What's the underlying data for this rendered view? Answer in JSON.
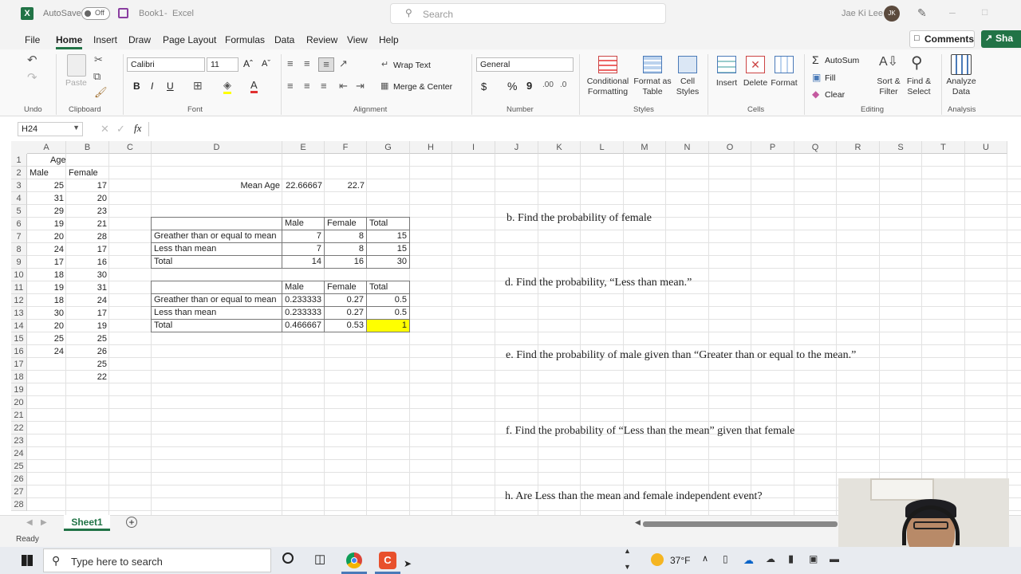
{
  "title_bar": {
    "autosave_label": "AutoSave",
    "autosave_state": "Off",
    "file_name": "Book1",
    "app_name": "Excel",
    "search_placeholder": "Search",
    "user_name": "Jae Ki Lee",
    "user_initials": "JK"
  },
  "menu": {
    "items": [
      "File",
      "Home",
      "Insert",
      "Draw",
      "Page Layout",
      "Formulas",
      "Data",
      "Review",
      "View",
      "Help"
    ],
    "active": "Home",
    "comments_label": "Comments",
    "share_label": "Sha"
  },
  "ribbon": {
    "undo_group": "Undo",
    "clipboard": {
      "group": "Clipboard",
      "paste": "Paste"
    },
    "font": {
      "group": "Font",
      "name": "Calibri",
      "size": "11",
      "bold": "B",
      "italic": "I",
      "underline": "U"
    },
    "alignment": {
      "group": "Alignment",
      "wrap_text": "Wrap Text",
      "merge_center": "Merge & Center"
    },
    "number": {
      "group": "Number",
      "format": "General",
      "currency": "$",
      "percent": "%",
      "comma": "9"
    },
    "styles": {
      "group": "Styles",
      "conditional": "Conditional Formatting",
      "format_table": "Format as Table",
      "cell_styles": "Cell Styles"
    },
    "cells": {
      "group": "Cells",
      "insert": "Insert",
      "delete": "Delete",
      "format": "Format"
    },
    "editing": {
      "group": "Editing",
      "autosum": "AutoSum",
      "fill": "Fill",
      "clear": "Clear",
      "sort_filter": "Sort & Filter",
      "find_select": "Find & Select"
    },
    "analysis": {
      "group": "Analysis",
      "analyze": "Analyze Data"
    }
  },
  "formula_bar": {
    "name_box": "H24",
    "fx": "fx",
    "value": ""
  },
  "columns": [
    "A",
    "B",
    "C",
    "D",
    "E",
    "F",
    "G",
    "H",
    "I",
    "J",
    "K",
    "L",
    "M",
    "N",
    "O",
    "P",
    "Q",
    "R",
    "S",
    "T",
    "U"
  ],
  "rows": [
    "1",
    "2",
    "3",
    "4",
    "5",
    "6",
    "7",
    "8",
    "9",
    "10",
    "11",
    "12",
    "13",
    "14",
    "15",
    "16",
    "17",
    "18",
    "19",
    "20",
    "21",
    "22",
    "23",
    "24",
    "25",
    "26",
    "27",
    "28"
  ],
  "data": {
    "age_header": "Age",
    "male_header": "Male",
    "female_header": "Female",
    "male_ages": [
      "25",
      "31",
      "29",
      "19",
      "20",
      "24",
      "17",
      "18",
      "19",
      "18",
      "30",
      "20",
      "25",
      "24"
    ],
    "female_ages": [
      "17",
      "20",
      "23",
      "21",
      "28",
      "17",
      "16",
      "30",
      "31",
      "24",
      "17",
      "19",
      "25",
      "26",
      "25",
      "22"
    ],
    "mean_label": "Mean Age",
    "mean_male": "22.66667",
    "mean_female": "22.7"
  },
  "table1": {
    "headers": [
      "Male",
      "Female",
      "Total"
    ],
    "rows": [
      {
        "label": "Greather than or equal to mean",
        "values": [
          "7",
          "8",
          "15"
        ]
      },
      {
        "label": "Less than mean",
        "values": [
          "7",
          "8",
          "15"
        ]
      },
      {
        "label": "Total",
        "values": [
          "14",
          "16",
          "30"
        ]
      }
    ]
  },
  "table2": {
    "headers": [
      "Male",
      "Female",
      "Total"
    ],
    "rows": [
      {
        "label": "Greather than or equal to mean",
        "values": [
          "0.233333",
          "0.27",
          "0.5"
        ]
      },
      {
        "label": "Less than mean",
        "values": [
          "0.233333",
          "0.27",
          "0.5"
        ]
      },
      {
        "label": "Total",
        "values": [
          "0.466667",
          "0.53",
          "1"
        ]
      }
    ],
    "highlight_color": "#ffff00"
  },
  "questions": {
    "b": "b. Find the probability of female",
    "d": "d. Find the probability, “Less than mean.”",
    "e": "e. Find the probability of male given than “Greater than or equal to the mean.”",
    "f": "f. Find the probability of “Less than the mean” given that female",
    "h": "h. Are Less than the mean and female independent event?"
  },
  "sheet_tab": "Sheet1",
  "status": "Ready",
  "taskbar": {
    "search_placeholder": "Type here to search",
    "temperature": "37°F"
  },
  "colors": {
    "excel_green": "#217346",
    "accent_red": "#c4302b"
  }
}
